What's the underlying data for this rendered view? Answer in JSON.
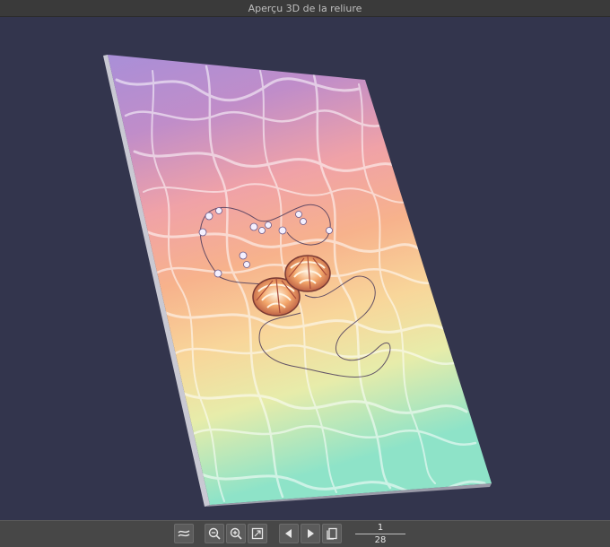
{
  "window": {
    "title": "Aperçu 3D de la reliure"
  },
  "toolbar": {
    "buttons": [
      {
        "icon": "binding-curve-icon"
      },
      {
        "icon": "zoom-out-icon"
      },
      {
        "icon": "zoom-in-icon"
      },
      {
        "icon": "fit-view-icon"
      },
      {
        "icon": "previous-page-icon"
      },
      {
        "icon": "next-page-icon"
      },
      {
        "icon": "page-spread-icon"
      }
    ]
  },
  "pager": {
    "current": "1",
    "total": "28"
  },
  "colors": {
    "background": "#33354d",
    "cover_top": "#9d7fd6",
    "cover_middle": "#f4a98d",
    "cover_lower": "#f7dfa2",
    "cover_bottom": "#8ee0c2"
  }
}
